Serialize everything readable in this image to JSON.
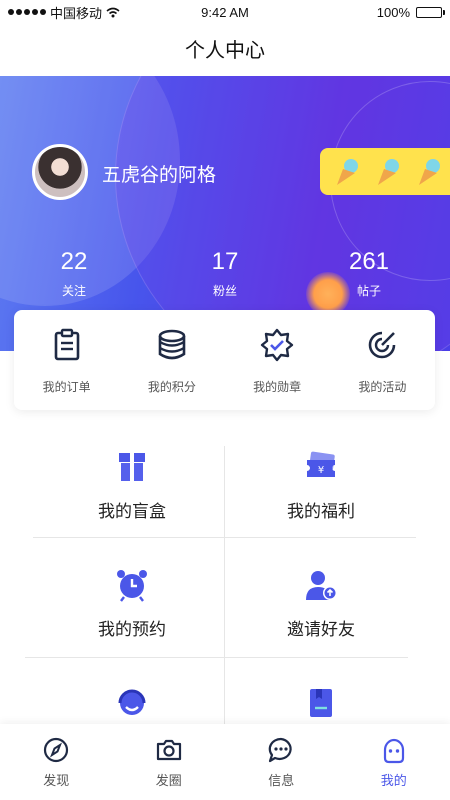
{
  "status_bar": {
    "carrier": "中国移动",
    "time": "9:42 AM",
    "battery": "100%"
  },
  "header": {
    "title": "个人中心"
  },
  "profile": {
    "username": "五虎谷的阿格",
    "badges": [
      "ice-cream-icon",
      "ice-cream-icon",
      "ice-cream-icon"
    ],
    "stats": [
      {
        "value": "22",
        "label": "关注"
      },
      {
        "value": "17",
        "label": "粉丝"
      },
      {
        "value": "261",
        "label": "帖子"
      }
    ]
  },
  "quick_menu": [
    {
      "label": "我的订单",
      "icon": "clipboard-icon"
    },
    {
      "label": "我的积分",
      "icon": "database-icon"
    },
    {
      "label": "我的勋章",
      "icon": "medal-icon"
    },
    {
      "label": "我的活动",
      "icon": "activity-icon"
    }
  ],
  "grid": [
    {
      "label": "我的盲盒",
      "icon": "gift-box-icon"
    },
    {
      "label": "我的福利",
      "icon": "coupon-icon"
    },
    {
      "label": "我的预约",
      "icon": "alarm-clock-icon"
    },
    {
      "label": "邀请好友",
      "icon": "add-user-icon"
    },
    {
      "label": "",
      "icon": "customer-service-icon"
    },
    {
      "label": "",
      "icon": "book-icon"
    }
  ],
  "tab_bar": [
    {
      "label": "发现",
      "icon": "compass-icon",
      "active": false
    },
    {
      "label": "发圈",
      "icon": "camera-icon",
      "active": false
    },
    {
      "label": "信息",
      "icon": "chat-icon",
      "active": false
    },
    {
      "label": "我的",
      "icon": "user-face-icon",
      "active": true
    }
  ],
  "colors": {
    "primary": "#4b57e8",
    "accent_yellow": "#ffe24d",
    "icon_dark": "#1f2a44"
  }
}
